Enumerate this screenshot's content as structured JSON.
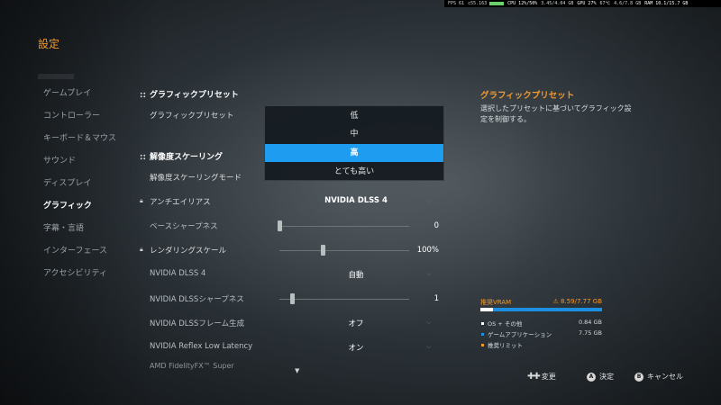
{
  "perf": {
    "fps": "FPS 61",
    "frametime": "c55.163",
    "cpu": "CPU 12%/50%",
    "cpu_extra": "3.45/4.04 GB",
    "gpu": "GPU 27%",
    "gpu_temp": "67℃",
    "gpu_mem": "4.6/7.8 GB",
    "ram": "RAM 10.1/15.7 GB"
  },
  "title": "設定",
  "nav": {
    "items": [
      {
        "label": "ゲームプレイ",
        "active": false
      },
      {
        "label": "コントローラー",
        "active": false
      },
      {
        "label": "キーボード＆マウス",
        "active": false
      },
      {
        "label": "サウンド",
        "active": false
      },
      {
        "label": "ディスプレイ",
        "active": false
      },
      {
        "label": "グラフィック",
        "active": true
      },
      {
        "label": "字幕・言語",
        "active": false
      },
      {
        "label": "インターフェース",
        "active": false
      },
      {
        "label": "アクセシビリティ",
        "active": false
      }
    ]
  },
  "settings": {
    "section1": "グラフィックプリセット",
    "preset_label": "グラフィックプリセット",
    "section2": "解像度スケーリング",
    "scaling_mode_label": "解像度スケーリングモード",
    "antialias_label": "アンチエイリアス",
    "antialias_value": "NVIDIA DLSS 4",
    "sharpness_label": "ベースシャープネス",
    "sharpness_value": "0",
    "sharpness_level": 0.0,
    "render_scale_label": "レンダリングスケール",
    "render_scale_value": "100%",
    "render_scale_level": 0.33,
    "dlss_label": "NVIDIA DLSS 4",
    "dlss_value": "自動",
    "dlss_sharp_label": "NVIDIA DLSSシャープネス",
    "dlss_sharp_value": "1",
    "dlss_sharp_level": 0.1,
    "framegen_label": "NVIDIA DLSSフレーム生成",
    "framegen_value": "オフ",
    "reflex_label": "NVIDIA Reflex Low Latency",
    "reflex_value": "オン",
    "fade_label": "AMD FidelityFX™ Super"
  },
  "dropdown": {
    "options": [
      "低",
      "中",
      "高",
      "とても高い"
    ],
    "selected": "高"
  },
  "info": {
    "title": "グラフィックプリセット",
    "description": "選択したプリセットに基づいてグラフィック設定を制御する。"
  },
  "vram": {
    "title": "推奨VRAM",
    "usage": "8.59/7.77 GB",
    "usage_fraction": 0.9,
    "rows": [
      {
        "label": "OS + その他",
        "value": "0.84 GB",
        "color": "#ffffff"
      },
      {
        "label": "ゲームアプリケーション",
        "value": "7.75 GB",
        "color": "#1d8fe0"
      },
      {
        "label": "推奨リミット",
        "value": "",
        "color": "#f29a2e"
      }
    ]
  },
  "controls": {
    "change": "変更",
    "confirm": "決定",
    "cancel": "キャンセル",
    "confirm_key": "A",
    "cancel_key": "B"
  }
}
